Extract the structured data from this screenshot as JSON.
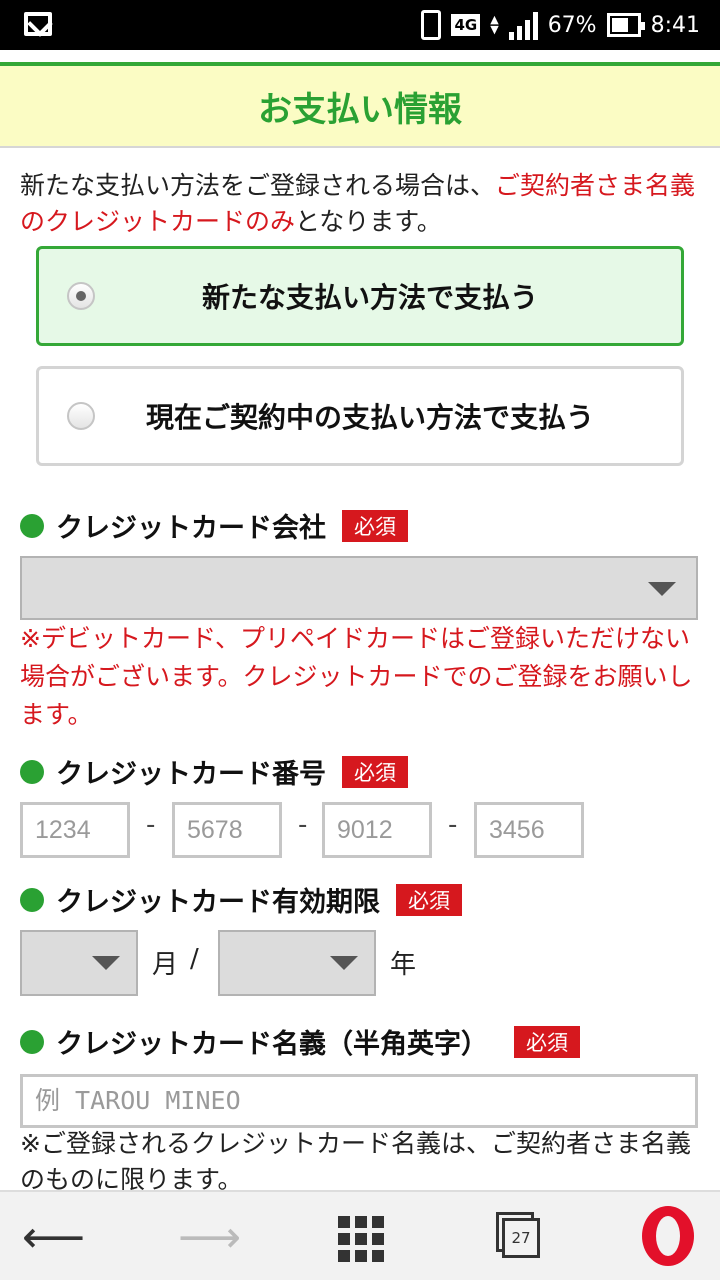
{
  "status_bar": {
    "network": "4G",
    "battery": "67%",
    "time": "8:41"
  },
  "header": {
    "title": "お支払い情報"
  },
  "intro": {
    "text_before": "新たな支払い方法をご登録される場合は、",
    "text_red": "ご契約者さま名義のクレジットカードのみ",
    "text_after": "となります。"
  },
  "payment_options": [
    {
      "label": "新たな支払い方法で支払う",
      "selected": true
    },
    {
      "label": "現在ご契約中の支払い方法で支払う",
      "selected": false
    }
  ],
  "card_company": {
    "label": "クレジットカード会社",
    "required": "必須",
    "note": "※デビットカード、プリペイドカードはご登録いただけない場合がございます。クレジットカードでのご登録をお願いします。"
  },
  "card_number": {
    "label": "クレジットカード番号",
    "required": "必須",
    "placeholders": [
      "1234",
      "5678",
      "9012",
      "3456"
    ],
    "separator": "-"
  },
  "card_expiry": {
    "label": "クレジットカード有効期限",
    "required": "必須",
    "month_unit": "月",
    "slash": "/",
    "year_unit": "年"
  },
  "card_name": {
    "label": "クレジットカード名義（半角英字）",
    "required": "必須",
    "placeholder": "例 TAROU MINEO",
    "note": "※ご登録されるクレジットカード名義は、ご契約者さま名義のものに限ります。"
  },
  "navbar": {
    "tab_count": "27"
  },
  "colors": {
    "accent_green": "#2aa133",
    "required_red": "#d6181e",
    "header_bg": "#fbfcc4"
  }
}
